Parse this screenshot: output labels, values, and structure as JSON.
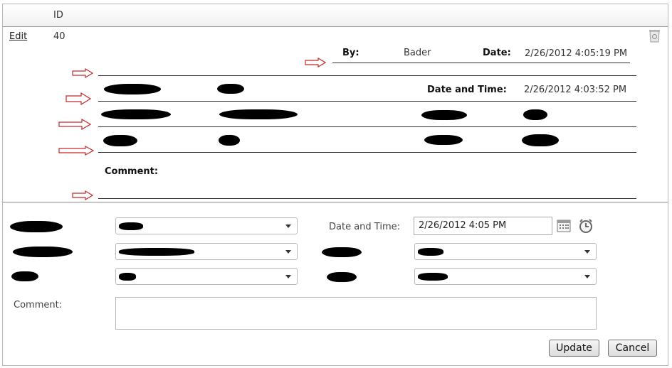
{
  "grid": {
    "header": {
      "id_label": "ID"
    },
    "row": {
      "edit_link": "Edit",
      "id_value": "40"
    }
  },
  "detail": {
    "by_label": "By:",
    "by_value": "Bader",
    "date_label": "Date:",
    "date_value": "2/26/2012 4:05:19 PM",
    "date_time_label": "Date and Time:",
    "date_time_value": "2/26/2012 4:03:52 PM",
    "comment_label": "Comment:"
  },
  "form": {
    "date_time_label": "Date and Time:",
    "date_time_value": "2/26/2012 4:05 PM",
    "comment_label": "Comment:",
    "update_button": "Update",
    "cancel_button": "Cancel"
  },
  "icons": {
    "delete": "recycle-bin-icon",
    "calendar": "calendar-icon",
    "clock": "clock-icon",
    "arrow": "right-arrow-icon"
  },
  "colors": {
    "arrow": "#c62828",
    "line": "#2d2d2d"
  }
}
